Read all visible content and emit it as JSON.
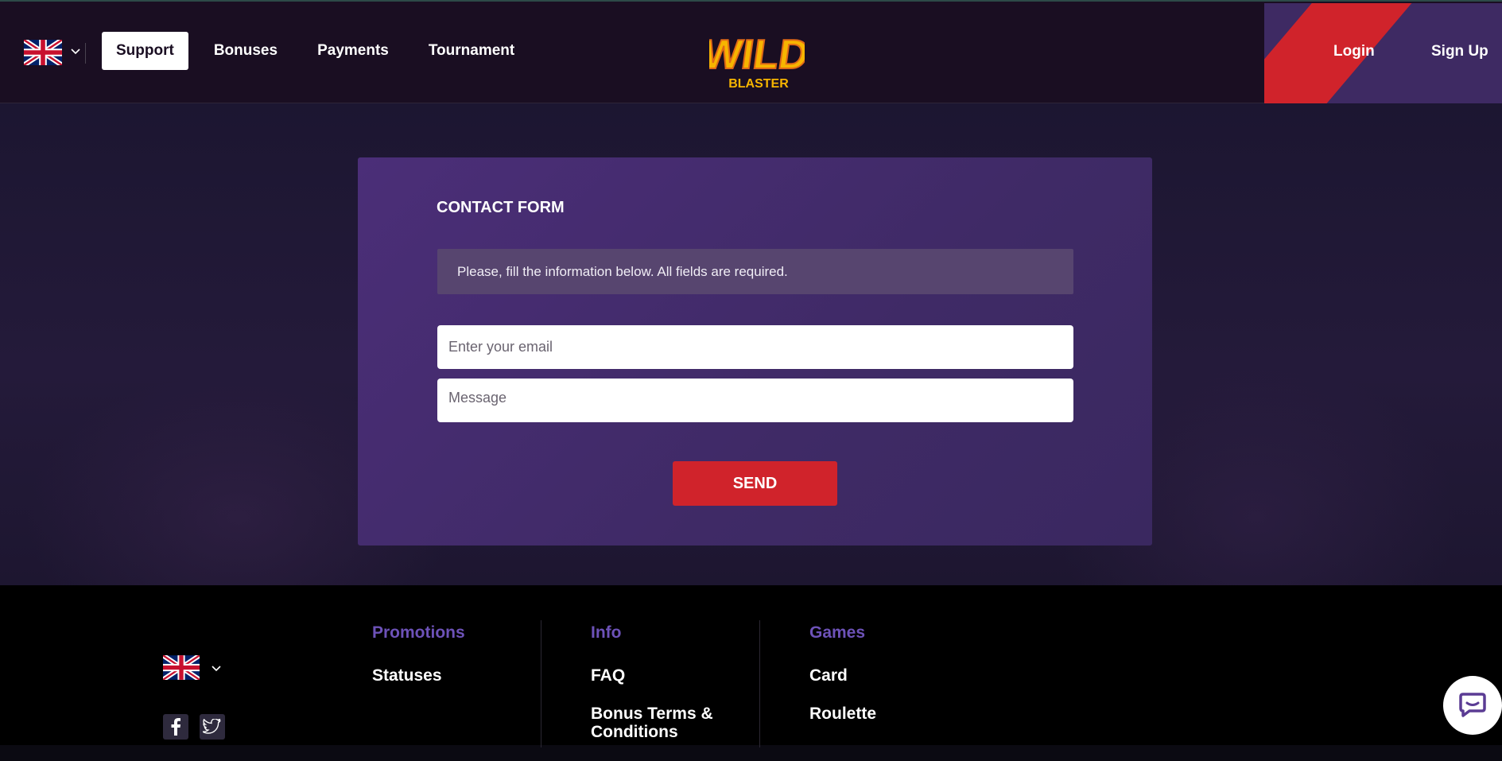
{
  "header": {
    "language": "English",
    "nav": [
      {
        "label": "Support",
        "active": true
      },
      {
        "label": "Bonuses",
        "active": false
      },
      {
        "label": "Payments",
        "active": false
      },
      {
        "label": "Tournament",
        "active": false
      }
    ],
    "logo": {
      "word1": "WILD",
      "word2": "BLASTER"
    },
    "login_label": "Login",
    "signup_label": "Sign Up"
  },
  "contact": {
    "title": "CONTACT FORM",
    "notice": "Please, fill the information below. All fields are required.",
    "email_placeholder": "Enter your email",
    "message_placeholder": "Message",
    "send_label": "SEND"
  },
  "footer": {
    "language": "English",
    "columns": [
      {
        "title": "Promotions",
        "links": [
          "Statuses"
        ]
      },
      {
        "title": "Info",
        "links": [
          "FAQ",
          "Bonus Terms & Conditions"
        ]
      },
      {
        "title": "Games",
        "links": [
          "Card",
          "Roulette"
        ]
      }
    ],
    "social": [
      "facebook-icon",
      "twitter-icon"
    ]
  },
  "colors": {
    "accent_red": "#d0232b",
    "card_purple": "#4b2e78",
    "footer_title": "#6d52b8"
  }
}
